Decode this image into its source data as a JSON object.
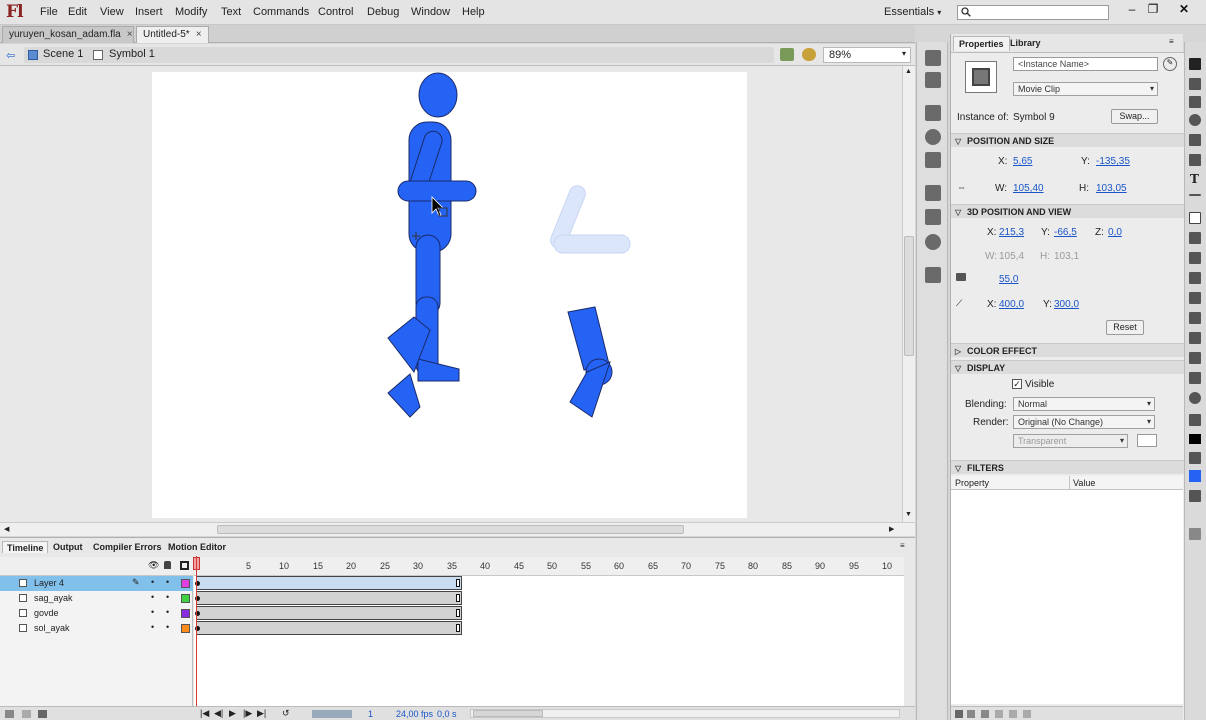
{
  "app": {
    "logo": "Fl"
  },
  "menu": [
    "File",
    "Edit",
    "View",
    "Insert",
    "Modify",
    "Text",
    "Commands",
    "Control",
    "Debug",
    "Window",
    "Help"
  ],
  "workspace": {
    "label": "Essentials",
    "search_placeholder": ""
  },
  "window_controls": [
    "minimize",
    "restore",
    "close"
  ],
  "doc_tabs": [
    {
      "label": "yuruyen_kosan_adam.fla",
      "active": false
    },
    {
      "label": "Untitled-5*",
      "active": true
    }
  ],
  "breadcrumb": {
    "scene": "Scene 1",
    "symbol": "Symbol 1"
  },
  "zoom": "89%",
  "properties": {
    "tabs": [
      "Properties",
      "Library"
    ],
    "instance_name_placeholder": "<Instance Name>",
    "type": "Movie Clip",
    "instance_of_label": "Instance of:",
    "instance_of_value": "Symbol 9",
    "swap_label": "Swap...",
    "pos_size": {
      "title": "POSITION AND SIZE",
      "x_label": "X:",
      "x": "5,65",
      "y_label": "Y:",
      "y": "-135,35",
      "w_label": "W:",
      "w": "105,40",
      "h_label": "H:",
      "h": "103,05"
    },
    "pos3d": {
      "title": "3D POSITION AND VIEW",
      "x_label": "X:",
      "x": "215,3",
      "y_label": "Y:",
      "y": "-66,5",
      "z_label": "Z:",
      "z": "0,0",
      "w_label": "W:",
      "w": "105,4",
      "h_label": "H:",
      "h": "103,1",
      "persp": "55,0",
      "vx_label": "X:",
      "vx": "400,0",
      "vy_label": "Y:",
      "vy": "300,0",
      "reset": "Reset"
    },
    "color_effect": {
      "title": "COLOR EFFECT"
    },
    "display": {
      "title": "DISPLAY",
      "visible_label": "Visible",
      "blending_label": "Blending:",
      "blending": "Normal",
      "render_label": "Render:",
      "render": "Original (No Change)",
      "transparent": "Transparent"
    },
    "filters": {
      "title": "FILTERS",
      "col_property": "Property",
      "col_value": "Value"
    }
  },
  "timeline": {
    "tabs": [
      "Timeline",
      "Output",
      "Compiler Errors",
      "Motion Editor"
    ],
    "frame_numbers": [
      "5",
      "10",
      "15",
      "20",
      "25",
      "30",
      "35",
      "40",
      "45",
      "50",
      "55",
      "60",
      "65",
      "70",
      "75",
      "80",
      "85",
      "90",
      "95",
      "10"
    ],
    "layers": [
      {
        "name": "Layer 4",
        "color": "#e040e0",
        "selected": true
      },
      {
        "name": "sag_ayak",
        "color": "#40d040",
        "selected": false
      },
      {
        "name": "govde",
        "color": "#8a2be2",
        "selected": false
      },
      {
        "name": "sol_ayak",
        "color": "#ff8c1a",
        "selected": false
      }
    ],
    "footer": {
      "frame": "1",
      "fps": "24,00 fps",
      "time": "0,0 s"
    }
  },
  "colors": {
    "figure": "#2563f5",
    "ghost": "#dce6fb",
    "accent": "#1a56c8"
  }
}
